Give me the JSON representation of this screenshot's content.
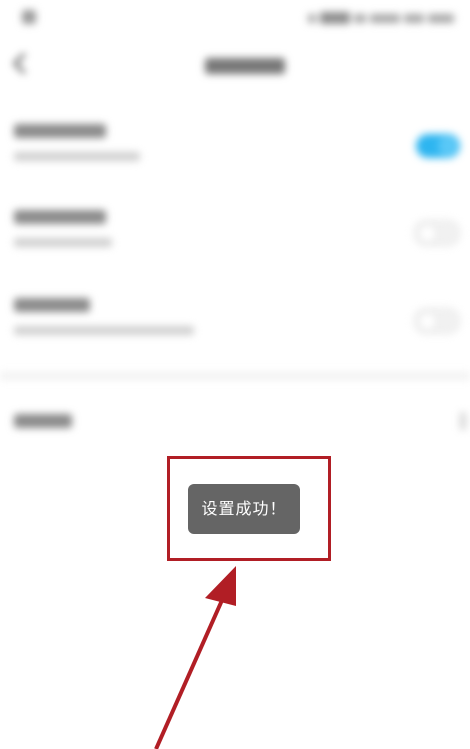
{
  "toast": {
    "message": "设置成功！"
  },
  "settings": {
    "rows": [
      {
        "toggle_state": "on"
      },
      {
        "toggle_state": "off"
      },
      {
        "toggle_state": "off"
      }
    ]
  },
  "colors": {
    "toggle_on": "#2db5f0",
    "toast_bg": "#656565",
    "annotation_red": "#b11e25"
  },
  "icons": {
    "back": "back-arrow-icon",
    "chevron": "chevron-right-icon"
  }
}
